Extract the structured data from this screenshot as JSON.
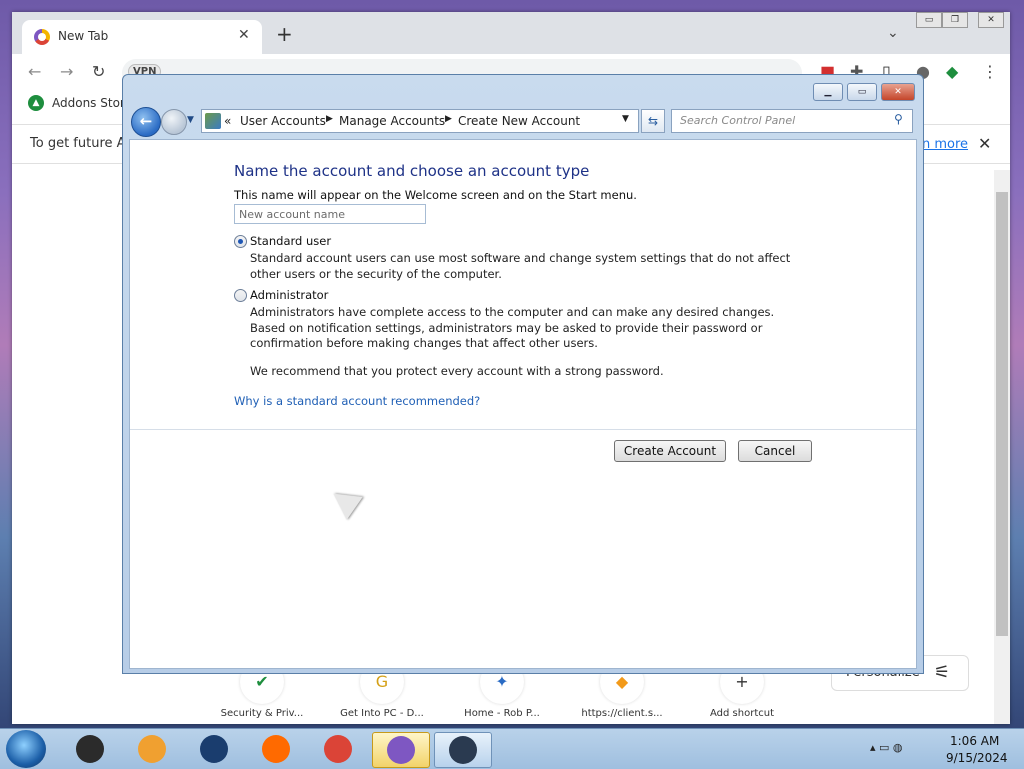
{
  "browser": {
    "tab_title": "New Tab",
    "close_tab": "✕",
    "new_tab": "+",
    "tab_search": "⌄",
    "window_controls": [
      "▭",
      "❐",
      "✕"
    ],
    "vpn_badge": "VPN",
    "bookmarks": [
      {
        "label": "Addons Store"
      }
    ],
    "infobar_text": "To get future Av",
    "infobar_link": "n more",
    "infobar_close": "✕",
    "customize_label": "Personalize",
    "shortcuts": [
      {
        "label": "Security & Priv...",
        "icon": "✔",
        "color": "#1e8e3e"
      },
      {
        "label": "Get Into PC - D...",
        "icon": "G",
        "color": "#d4a017"
      },
      {
        "label": "Home - Rob P...",
        "icon": "✦",
        "color": "#2a6bc4"
      },
      {
        "label": "https://client.s...",
        "icon": "◆",
        "color": "#f29a1a"
      },
      {
        "label": "Add shortcut",
        "icon": "+",
        "color": "#333333"
      }
    ]
  },
  "control_panel": {
    "window_controls": {
      "minimize": "▁",
      "maximize": "▭",
      "close": "✕"
    },
    "breadcrumb": [
      "User Accounts",
      "Manage Accounts",
      "Create New Account"
    ],
    "breadcrumb_prefix": "«",
    "search_placeholder": "Search Control Panel",
    "heading": "Name the account and choose an account type",
    "subtitle": "This name will appear on the Welcome screen and on the Start menu.",
    "name_placeholder": "New account name",
    "options": [
      {
        "label": "Standard user",
        "selected": true,
        "description": "Standard account users can use most software and change system settings that do not affect other users or the security of the computer."
      },
      {
        "label": "Administrator",
        "selected": false,
        "description": "Administrators have complete access to the computer and can make any desired changes. Based on notification settings, administrators may be asked to provide their password or confirmation before making changes that affect other users."
      }
    ],
    "recommendation": "We recommend that you protect every account with a strong password.",
    "help_link": "Why is a standard account recommended?",
    "create_button": "Create Account",
    "cancel_button": "Cancel"
  },
  "taskbar": {
    "time": "1:06 AM",
    "date": "9/15/2024",
    "apps": [
      {
        "name": "folder",
        "color": "#2b2b2b"
      },
      {
        "name": "media-player",
        "color": "#f0a030"
      },
      {
        "name": "globe",
        "color": "#1a3d6e"
      },
      {
        "name": "firefox",
        "color": "#ff6a00"
      },
      {
        "name": "chrome",
        "color": "#db4437"
      },
      {
        "name": "avast-browser",
        "color": "#7e57c2"
      },
      {
        "name": "control-panel",
        "color": "#2a3a50"
      }
    ]
  },
  "colors": {
    "heading": "#1e3287",
    "link": "#1f5fb5",
    "window_frame": "#b7cde7"
  }
}
